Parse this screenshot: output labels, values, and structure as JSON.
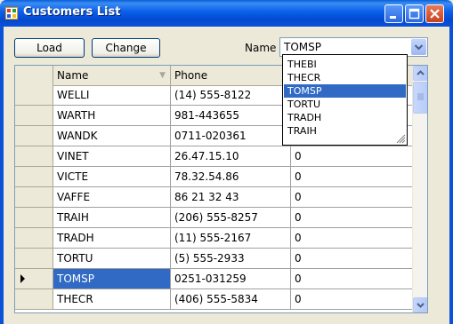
{
  "window": {
    "title": "Customers List",
    "icon": "app-window-icon",
    "controls": [
      "minimize-icon",
      "maximize-icon",
      "close-icon"
    ]
  },
  "toolbar": {
    "load_label": "Load",
    "change_label": "Change",
    "name_label": "Name",
    "name_value": "TOMSP"
  },
  "dropdown": {
    "options": [
      "THEBI",
      "THECR",
      "TOMSP",
      "TORTU",
      "TRADH",
      "TRAIH"
    ],
    "selected": "TOMSP"
  },
  "grid": {
    "columns": [
      "Name",
      "Phone"
    ],
    "rows": [
      {
        "name": "WELLI",
        "phone": "(14) 555-8122",
        "extra": ""
      },
      {
        "name": "WARTH",
        "phone": "981-443655",
        "extra": ""
      },
      {
        "name": "WANDK",
        "phone": "0711-020361",
        "extra": ""
      },
      {
        "name": "VINET",
        "phone": "26.47.15.10",
        "extra": "0"
      },
      {
        "name": "VICTE",
        "phone": "78.32.54.86",
        "extra": "0"
      },
      {
        "name": "VAFFE",
        "phone": "86 21 32 43",
        "extra": "0"
      },
      {
        "name": "TRAIH",
        "phone": "(206) 555-8257",
        "extra": "0"
      },
      {
        "name": "TRADH",
        "phone": "(11) 555-2167",
        "extra": "0"
      },
      {
        "name": "TORTU",
        "phone": "(5) 555-2933",
        "extra": "0"
      },
      {
        "name": "TOMSP",
        "phone": "0251-031259",
        "extra": "0"
      },
      {
        "name": "THECR",
        "phone": "(406) 555-5834",
        "extra": "0"
      }
    ],
    "current_row": 9,
    "selected_color": "#316ac5"
  },
  "colors": {
    "titlebar": "#0a5ee8",
    "window_bg": "#ece9d8",
    "selection": "#316ac5"
  }
}
